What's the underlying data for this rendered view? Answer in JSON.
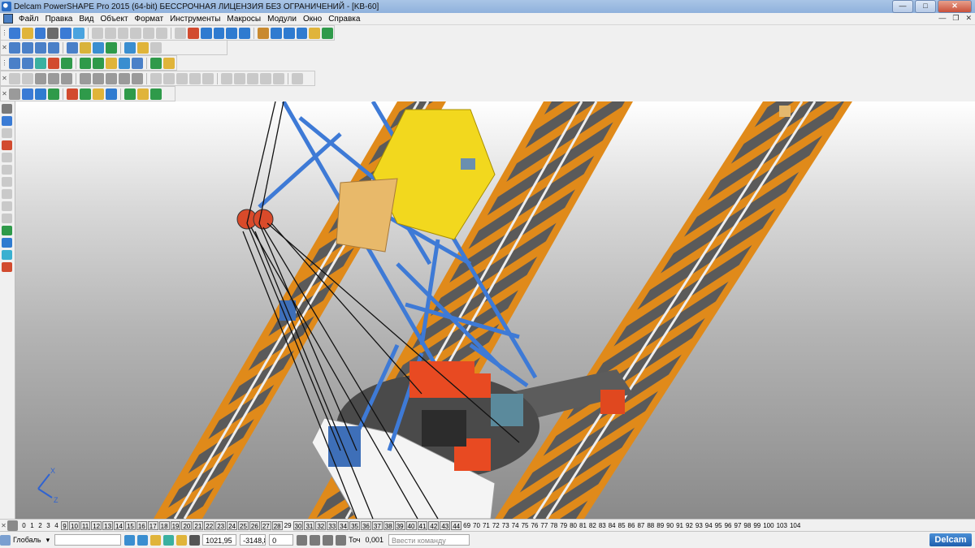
{
  "window": {
    "title": "Delcam PowerSHAPE Pro 2015 (64-bit) БЕССРОЧНАЯ ЛИЦЕНЗИЯ БЕЗ ОГРАНИЧЕНИЙ - [KB-60]",
    "minimize": "—",
    "maximize": "□",
    "close": "✕"
  },
  "menu": {
    "items": [
      "Файл",
      "Правка",
      "Вид",
      "Объект",
      "Формат",
      "Инструменты",
      "Макросы",
      "Модули",
      "Окно",
      "Справка"
    ],
    "mdi_minimize": "—",
    "mdi_restore": "❐",
    "mdi_close": "✕"
  },
  "toolbars": {
    "row1_colors": [
      "#3a7bd5",
      "#e0b43a",
      "#3a7bd5",
      "#6b6b6b",
      "#3a7bd5",
      "#4aa3df",
      "#c9c9c9",
      "#c9c9c9",
      "#c9c9c9",
      "#c9c9c9",
      "#c9c9c9",
      "#c9c9c9",
      "#c9c9c9",
      "#d24b2f",
      "#2f7bd0",
      "#2f7bd0",
      "#2f7bd0",
      "#2f7bd0",
      "#c98a2f",
      "#2f7bd0",
      "#2f7bd0",
      "#2f7bd0",
      "#e0b43a",
      "#2f9a4a"
    ],
    "row2_colors": [
      "#4a80c8",
      "#4a80c8",
      "#4a80c8",
      "#4a80c8",
      "#4a80c8",
      "#d9b33a",
      "#3a8ed0",
      "#2f9a4a",
      "#3a8ed0",
      "#e0b43a",
      "#c9c9c9"
    ],
    "row3_colors": [
      "#4a80c8",
      "#4a80c8",
      "#3ab0a0",
      "#d24b2f",
      "#2f9a4a",
      "#2f9a4a",
      "#2f9a4a",
      "#e0b43a",
      "#3a8ed0",
      "#4a80c8",
      "#2f9a4a",
      "#e0b43a"
    ],
    "row4_colors": [
      "#c9c9c9",
      "#c9c9c9",
      "#9a9a9a",
      "#9a9a9a",
      "#9a9a9a",
      "#9a9a9a",
      "#9a9a9a",
      "#9a9a9a",
      "#9a9a9a",
      "#9a9a9a",
      "#c9c9c9",
      "#c9c9c9",
      "#c9c9c9",
      "#c9c9c9",
      "#c9c9c9",
      "#c9c9c9",
      "#c9c9c9",
      "#c9c9c9",
      "#c9c9c9",
      "#c9c9c9",
      "#c9c9c9"
    ],
    "row5_colors": [
      "#9a9a9a",
      "#3a7bd5",
      "#2f7bd0",
      "#2f9a4a",
      "#d24b2f",
      "#2f9a4a",
      "#e0b43a",
      "#2f7bd0",
      "#2f9a4a",
      "#e0b43a",
      "#2f9a4a"
    ]
  },
  "left_toolbar": {
    "colors": [
      "#7a7a7a",
      "#3a7bd5",
      "#c9c9c9",
      "#d24b2f",
      "#c9c9c9",
      "#c9c9c9",
      "#c9c9c9",
      "#c9c9c9",
      "#c9c9c9",
      "#c9c9c9",
      "#2f9a4a",
      "#2f7bd0",
      "#3ab0d0",
      "#d24b2f"
    ]
  },
  "axis": {
    "x": "X",
    "z": "Z"
  },
  "levels": {
    "boxed": [
      "9",
      "10",
      "11",
      "12",
      "13",
      "14",
      "15",
      "16",
      "17",
      "18",
      "19",
      "20",
      "21",
      "22",
      "23",
      "24",
      "25",
      "26",
      "27",
      "28",
      "30",
      "31",
      "32",
      "33",
      "34",
      "35",
      "36",
      "37",
      "38",
      "39",
      "40",
      "41",
      "42",
      "43",
      "44"
    ],
    "items": [
      "0",
      "1",
      "2",
      "3",
      "4",
      "9",
      "10",
      "11",
      "12",
      "13",
      "14",
      "15",
      "16",
      "17",
      "18",
      "19",
      "20",
      "21",
      "22",
      "23",
      "24",
      "25",
      "26",
      "27",
      "28",
      "29",
      "30",
      "31",
      "32",
      "33",
      "34",
      "35",
      "36",
      "37",
      "38",
      "39",
      "40",
      "41",
      "42",
      "43",
      "44",
      "69",
      "70",
      "71",
      "72",
      "73",
      "74",
      "75",
      "76",
      "77",
      "78",
      "79",
      "80",
      "81",
      "82",
      "83",
      "84",
      "85",
      "86",
      "87",
      "88",
      "89",
      "90",
      "91",
      "92",
      "93",
      "94",
      "95",
      "96",
      "97",
      "98",
      "99",
      "100",
      "103",
      "104"
    ]
  },
  "status": {
    "workplane": "Глобаль",
    "dropdown_arrow": "▾",
    "coord_x": "1021,95",
    "coord_y": "-3148,8",
    "coord_z": "0",
    "tolerance_label": "Точ",
    "tolerance_value": "0,001",
    "command_placeholder": "Ввести команду",
    "brand": "Delcam"
  }
}
